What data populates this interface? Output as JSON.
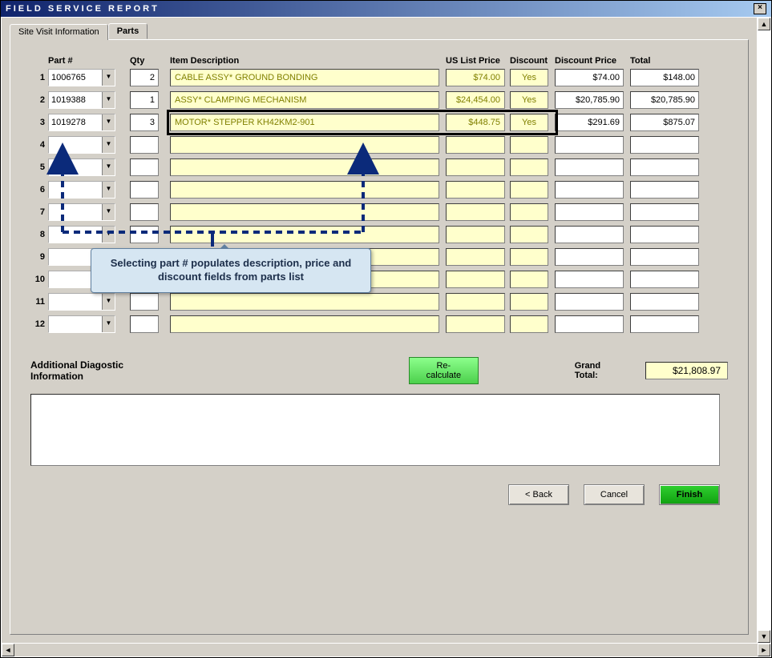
{
  "window": {
    "title": "FIELD SERVICE REPORT",
    "close_label": "×"
  },
  "tabs": {
    "tab1": "Site Visit Information",
    "tab2": "Parts"
  },
  "columns": {
    "part": "Part #",
    "qty": "Qty",
    "desc": "Item Description",
    "price": "US List Price",
    "disc": "Discount",
    "dprice": "Discount Price",
    "total": "Total"
  },
  "rows": {
    "r1": {
      "num": "1",
      "part": "1006765",
      "qty": "2",
      "desc": "CABLE ASSY* GROUND BONDING",
      "price": "$74.00",
      "disc": "Yes",
      "dprice": "$74.00",
      "total": "$148.00"
    },
    "r2": {
      "num": "2",
      "part": "1019388",
      "qty": "1",
      "desc": "ASSY* CLAMPING MECHANISM",
      "price": "$24,454.00",
      "disc": "Yes",
      "dprice": "$20,785.90",
      "total": "$20,785.90"
    },
    "r3": {
      "num": "3",
      "part": "1019278",
      "qty": "3",
      "desc": "MOTOR* STEPPER KH42KM2-901",
      "price": "$448.75",
      "disc": "Yes",
      "dprice": "$291.69",
      "total": "$875.07"
    },
    "r4": {
      "num": "4",
      "part": "",
      "qty": "",
      "desc": "",
      "price": "",
      "disc": "",
      "dprice": "",
      "total": ""
    },
    "r5": {
      "num": "5",
      "part": "",
      "qty": "",
      "desc": "",
      "price": "",
      "disc": "",
      "dprice": "",
      "total": ""
    },
    "r6": {
      "num": "6",
      "part": "",
      "qty": "",
      "desc": "",
      "price": "",
      "disc": "",
      "dprice": "",
      "total": ""
    },
    "r7": {
      "num": "7",
      "part": "",
      "qty": "",
      "desc": "",
      "price": "",
      "disc": "",
      "dprice": "",
      "total": ""
    },
    "r8": {
      "num": "8",
      "part": "",
      "qty": "",
      "desc": "",
      "price": "",
      "disc": "",
      "dprice": "",
      "total": ""
    },
    "r9": {
      "num": "9",
      "part": "",
      "qty": "",
      "desc": "",
      "price": "",
      "disc": "",
      "dprice": "",
      "total": ""
    },
    "r10": {
      "num": "10",
      "part": "",
      "qty": "",
      "desc": "",
      "price": "",
      "disc": "",
      "dprice": "",
      "total": ""
    },
    "r11": {
      "num": "11",
      "part": "",
      "qty": "",
      "desc": "",
      "price": "",
      "disc": "",
      "dprice": "",
      "total": ""
    },
    "r12": {
      "num": "12",
      "part": "",
      "qty": "",
      "desc": "",
      "price": "",
      "disc": "",
      "dprice": "",
      "total": ""
    }
  },
  "callout": {
    "text": "Selecting part # populates description, price and discount fields from parts list"
  },
  "bottom": {
    "diag_label": "Additional Diagostic Information",
    "recalc": "Re-calculate",
    "grand_total_label": "Grand Total:",
    "grand_total_value": "$21,808.97"
  },
  "buttons": {
    "back": "< Back",
    "cancel": "Cancel",
    "finish": "Finish"
  }
}
